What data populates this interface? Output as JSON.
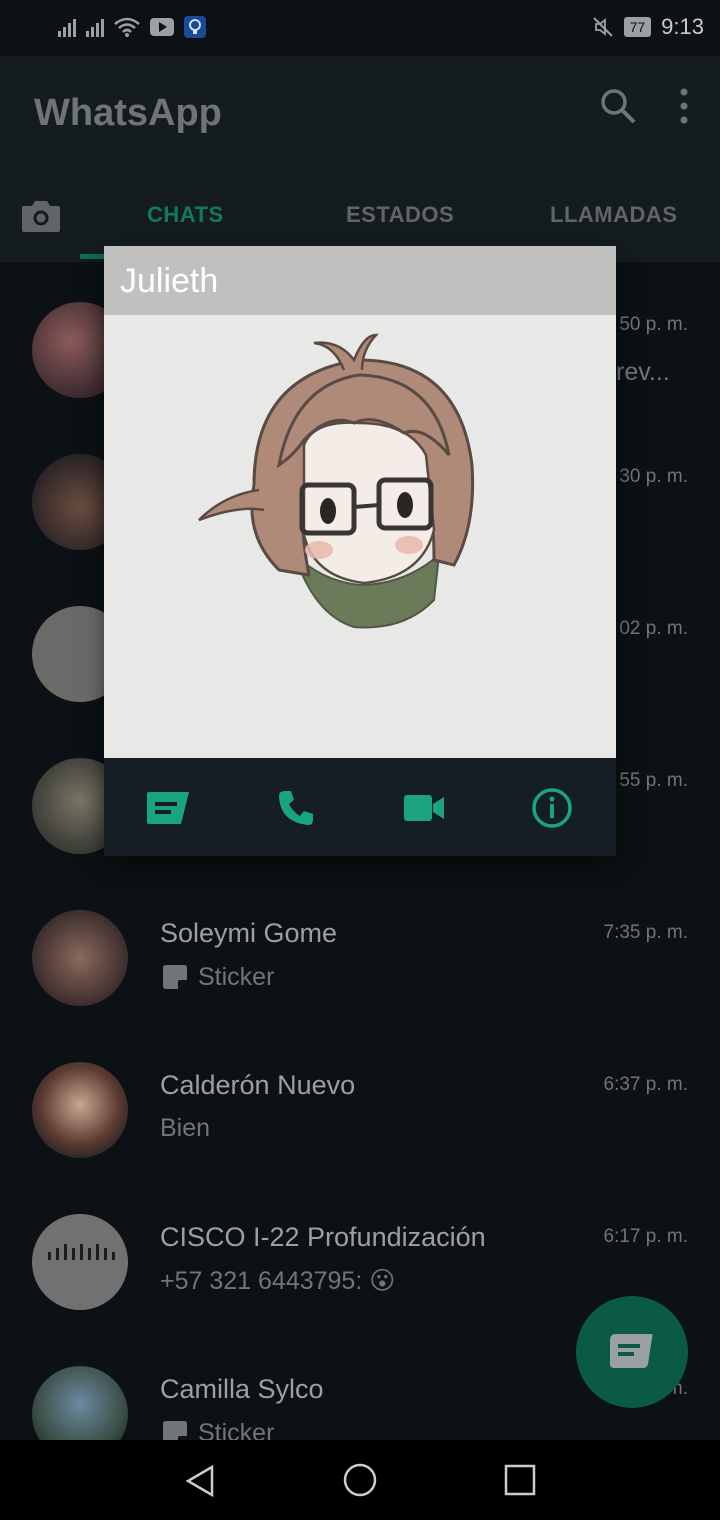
{
  "status_bar": {
    "time": "9:13",
    "battery": "77"
  },
  "app": {
    "title": "WhatsApp"
  },
  "tabs": [
    {
      "label": "CHATS"
    },
    {
      "label": "ESTADOS"
    },
    {
      "label": "LLAMADAS"
    }
  ],
  "chats": [
    {
      "name": "",
      "message": "rev...",
      "time": "50 p. m."
    },
    {
      "name": "",
      "message": "",
      "time": "30 p. m."
    },
    {
      "name": "",
      "message": "",
      "time": "02 p. m."
    },
    {
      "name": "",
      "message": "",
      "time": "55 p. m."
    },
    {
      "name": "Soleymi Gome",
      "message": "Sticker",
      "time": "7:35 p. m."
    },
    {
      "name": "Calderón Nuevo",
      "message": "Bien",
      "time": "6:37 p. m."
    },
    {
      "name": "CISCO I-22 Profundización",
      "message": "+57 321 6443795: 😮",
      "time": "6:17 p. m."
    },
    {
      "name": "Camilla Sylco",
      "message": "Sticker",
      "time": "m."
    }
  ],
  "popup": {
    "contact_name": "Julieth",
    "actions": [
      "message-icon",
      "call-icon",
      "video-icon",
      "info-icon"
    ]
  },
  "colors": {
    "accent": "#1aa37f",
    "header_gray": "#c0c0be",
    "background": "#0b1114"
  }
}
